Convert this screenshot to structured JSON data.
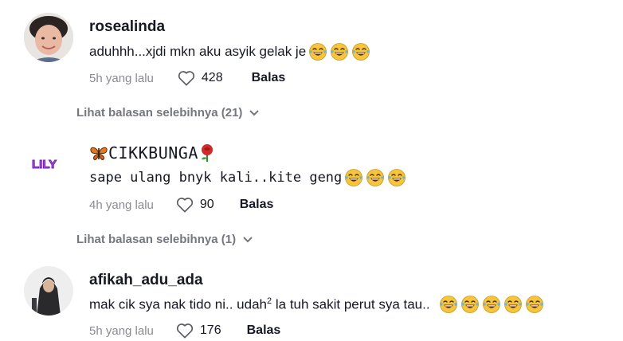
{
  "comments": [
    {
      "username": "rosealinda",
      "text": "aduhhh...xjdi mkn aku asyik gelak je",
      "emoji_count": 3,
      "time": "5h yang lalu",
      "likes": "428",
      "reply_label": "Balas",
      "view_more": "Lihat balasan selebihnya (21)"
    },
    {
      "username": "CIKKBUNGA",
      "text": "sape ulang bnyk kali..kite geng",
      "emoji_count": 3,
      "time": "4h yang lalu",
      "likes": "90",
      "reply_label": "Balas",
      "view_more": "Lihat balasan selebihnya (1)",
      "avatar_text": "LILY"
    },
    {
      "username": "afikah_adu_ada",
      "text_a": "mak cik sya nak tido ni.. udah",
      "text_sup": "2",
      "text_b": " la tuh sakit perut sya tau..",
      "emoji_count": 5,
      "time": "5h yang lalu",
      "likes": "176",
      "reply_label": "Balas"
    }
  ],
  "icons": {
    "like": "heart-outline-icon",
    "expand": "chevron-down-icon",
    "emoji": "laughing-tears-emoji",
    "name_prefix": "butterfly-icon",
    "name_suffix": "rose-icon"
  },
  "colors": {
    "text": "#161823",
    "muted": "#8a8b91",
    "emoji_face": "#f7c53c"
  }
}
